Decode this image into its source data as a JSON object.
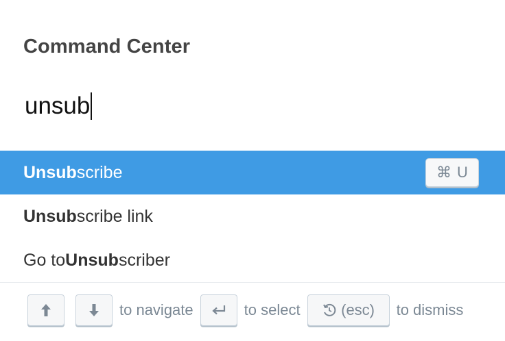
{
  "header": {
    "title": "Command Center"
  },
  "search": {
    "value": "unsub"
  },
  "results": [
    {
      "prefix": "",
      "match": "Unsub",
      "suffix": "scribe",
      "shortcut_symbol": "⌘",
      "shortcut_key": "U",
      "selected": true
    },
    {
      "prefix": "",
      "match": "Unsub",
      "suffix": "scribe link",
      "selected": false
    },
    {
      "prefix": "Go to ",
      "match": "Unsub",
      "suffix": "scriber",
      "selected": false
    }
  ],
  "footer": {
    "up_icon": "arrow-up-icon",
    "down_icon": "arrow-down-icon",
    "navigate_label": "to navigate",
    "enter_icon": "return-icon",
    "select_label": "to select",
    "esc_icon": "undo-icon",
    "esc_label": "(esc)",
    "dismiss_label": "to dismiss"
  },
  "colors": {
    "selected_bg": "#3f9be4",
    "text": "#333333",
    "muted": "#7b8894"
  }
}
